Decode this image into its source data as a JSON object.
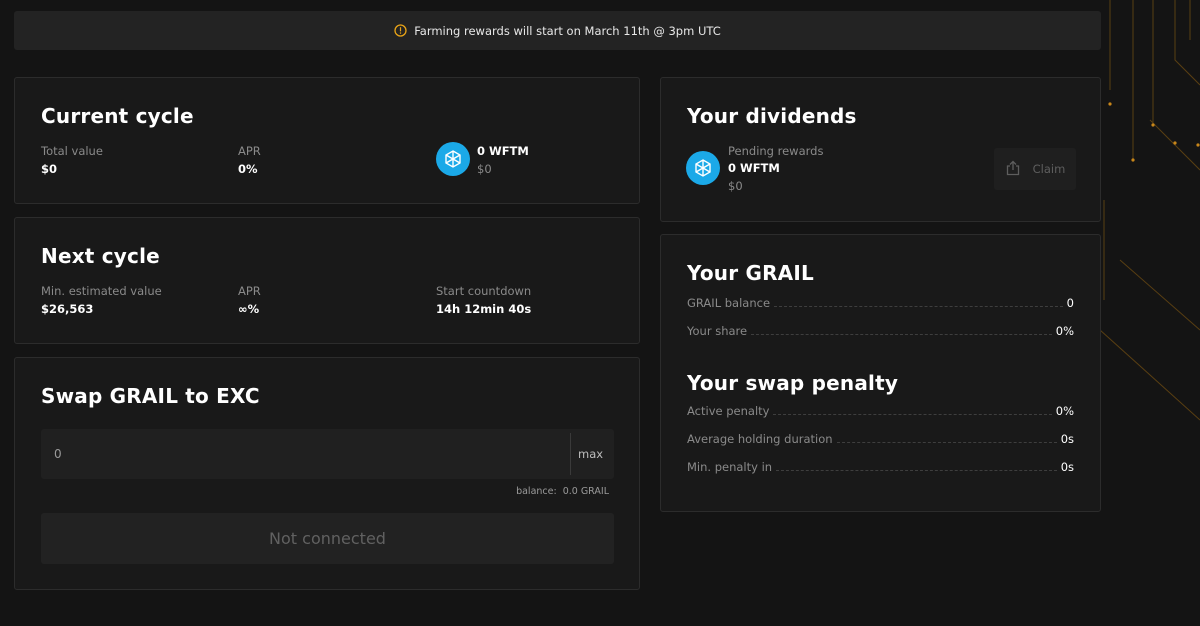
{
  "banner": {
    "text": "Farming rewards will start on March 11th @ 3pm UTC",
    "icon": "warning-circle-icon",
    "icon_color": "#e8a317"
  },
  "current_cycle": {
    "title": "Current cycle",
    "total_value_label": "Total value",
    "total_value": "$0",
    "apr_label": "APR",
    "apr": "0%",
    "reward_amount": "0 WFTM",
    "reward_usd": "$0"
  },
  "next_cycle": {
    "title": "Next cycle",
    "min_value_label": "Min. estimated value",
    "min_value": "$26,563",
    "apr_label": "APR",
    "apr": "∞%",
    "countdown_label": "Start countdown",
    "countdown": "14h 12min 40s"
  },
  "swap": {
    "title": "Swap GRAIL to EXC",
    "input_placeholder": "0",
    "max_label": "max",
    "balance_label": "balance:",
    "balance_value": "0.0 GRAIL",
    "button_label": "Not connected"
  },
  "dividends": {
    "title": "Your dividends",
    "pending_label": "Pending rewards",
    "pending_amount": "0 WFTM",
    "pending_usd": "$0",
    "claim_label": "Claim"
  },
  "grail": {
    "title": "Your GRAIL",
    "rows": [
      {
        "label": "GRAIL balance",
        "value": "0"
      },
      {
        "label": "Your share",
        "value": "0%"
      }
    ]
  },
  "penalty": {
    "title": "Your swap penalty",
    "rows": [
      {
        "label": "Active penalty",
        "value": "0%"
      },
      {
        "label": "Average holding duration",
        "value": "0s"
      },
      {
        "label": "Min. penalty in",
        "value": "0s"
      }
    ]
  },
  "colors": {
    "background": "#141414",
    "card": "#191919",
    "accent": "#e8a317",
    "token": "#1ba9e8"
  }
}
